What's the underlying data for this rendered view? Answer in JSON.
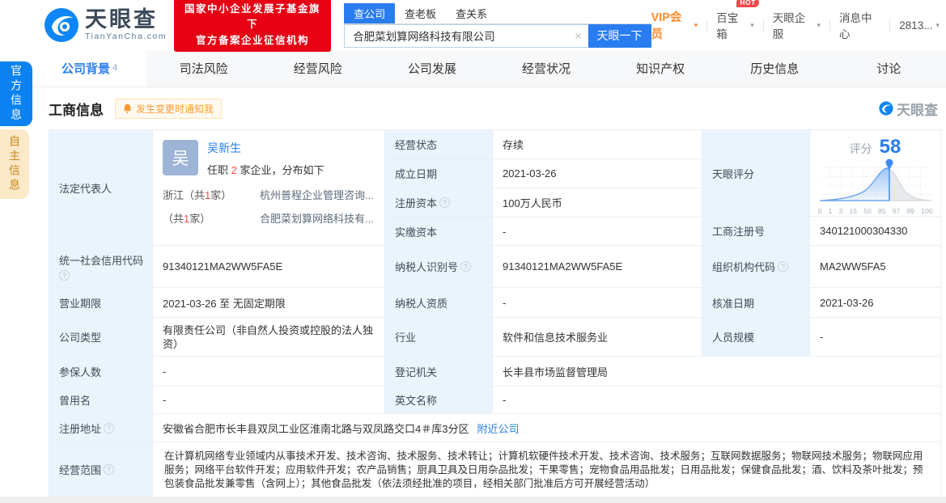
{
  "header": {
    "logo": {
      "title": "天眼查",
      "domain": "TianYanCha.com"
    },
    "cert_badge": {
      "line1": "国家中小企业发展子基金旗下",
      "line2": "官方备案企业征信机构"
    },
    "search": {
      "tabs": [
        {
          "label": "查公司"
        },
        {
          "label": "查老板"
        },
        {
          "label": "查关系"
        }
      ],
      "active_tab": "查公司",
      "value": "合肥菜划算网络科技有限公司",
      "clear_icon": "×",
      "button": "天眼一下"
    },
    "menu": {
      "vip": "VIP会员",
      "toolbox": "百宝箱",
      "hot_badge": "HOT",
      "services": "天眼企服",
      "messages": "消息中心",
      "account": "2813...",
      "caret": "▾"
    }
  },
  "nav": {
    "active": "公司背景",
    "tabs": [
      {
        "label": "公司背景",
        "count": "4"
      },
      {
        "label": "司法风险"
      },
      {
        "label": "经营风险"
      },
      {
        "label": "公司发展"
      },
      {
        "label": "经营状况"
      },
      {
        "label": "知识产权"
      },
      {
        "label": "历史信息"
      },
      {
        "label": "讨论"
      }
    ]
  },
  "side_tabs": {
    "official": "官方信息",
    "self": "自主信息"
  },
  "section": {
    "title": "工商信息",
    "notify": "发生变更时通知我",
    "watermark": "天眼查"
  },
  "legal_rep": {
    "label": "法定代表人",
    "avatar": "吴",
    "name": "吴新生",
    "role_prefix": "任职",
    "role_count": "2",
    "role_suffix": "家企业，分布如下",
    "dist": [
      {
        "region_pre": "浙江（共",
        "count": "1",
        "region_suf": "家）",
        "company": "杭州普程企业管理咨询..."
      },
      {
        "region_pre": "（共",
        "count": "1",
        "region_suf": "家）",
        "company": "合肥菜划算网络科技有..."
      }
    ]
  },
  "fields": {
    "status": {
      "label": "经营状态",
      "value": "存续"
    },
    "established": {
      "label": "成立日期",
      "value": "2021-03-26"
    },
    "reg_capital": {
      "label": "注册资本",
      "value": "100万人民币"
    },
    "paid_capital": {
      "label": "实缴资本",
      "value": "-"
    },
    "reg_number": {
      "label": "工商注册号",
      "value": "340121000304330"
    },
    "credit_code": {
      "label": "统一社会信用代码",
      "value": "91340121MA2WW5FA5E"
    },
    "taxpayer_id": {
      "label": "纳税人识别号",
      "value": "91340121MA2WW5FA5E"
    },
    "org_code": {
      "label": "组织机构代码",
      "value": "MA2WW5FA5"
    },
    "term": {
      "label": "营业期限",
      "value": "2021-03-26 至 无固定期限"
    },
    "taxpayer_qual": {
      "label": "纳税人资质",
      "value": "-"
    },
    "approval_date": {
      "label": "核准日期",
      "value": "2021-03-26"
    },
    "company_type": {
      "label": "公司类型",
      "value": "有限责任公司（非自然人投资或控股的法人独资）"
    },
    "industry": {
      "label": "行业",
      "value": "软件和信息技术服务业"
    },
    "staff_size": {
      "label": "人员规模",
      "value": "-"
    },
    "insured": {
      "label": "参保人数",
      "value": "-"
    },
    "authority": {
      "label": "登记机关",
      "value": "长丰县市场监督管理局"
    },
    "former_name": {
      "label": "曾用名",
      "value": "-"
    },
    "english_name": {
      "label": "英文名称",
      "value": "-"
    },
    "address": {
      "label": "注册地址",
      "value": "安徽省合肥市长丰县双凤工业区淮南北路与双凤路交口4＃库3分区",
      "link": "附近公司"
    },
    "scope": {
      "label": "经营范围",
      "value": "在计算机网络专业领域内从事技术开发、技术咨询、技术服务、技术转让；计算机软硬件技术开发、技术咨询、技术服务；互联网数据服务；物联网技术服务；物联网应用服务；网络平台软件开发；应用软件开发；农产品销售；厨具卫具及日用杂品批发；干果零售；宠物食品用品批发；日用品批发；保健食品批发；酒、饮料及茶叶批发；预包装食品批发兼零售（含网上）；其他食品批发（依法须经批准的项目，经相关部门批准后方可开展经营活动）"
    }
  },
  "evaluation": {
    "label": "天眼评分",
    "score_label": "评分",
    "score": "58"
  },
  "chart_data": {
    "type": "area",
    "title": "天眼评分分布曲线",
    "score": 58,
    "marker_value": 58,
    "x_ticks": [
      "0",
      "1",
      "3",
      "15",
      "50",
      "85",
      "97",
      "99",
      "100"
    ],
    "grid": true,
    "colors": {
      "curve": "#6aa5ee",
      "left_fill": "#bcd9f7",
      "right_fill": "#e7e9ec",
      "marker": "#3f8cf3",
      "score_text": "#2a7df0"
    }
  }
}
